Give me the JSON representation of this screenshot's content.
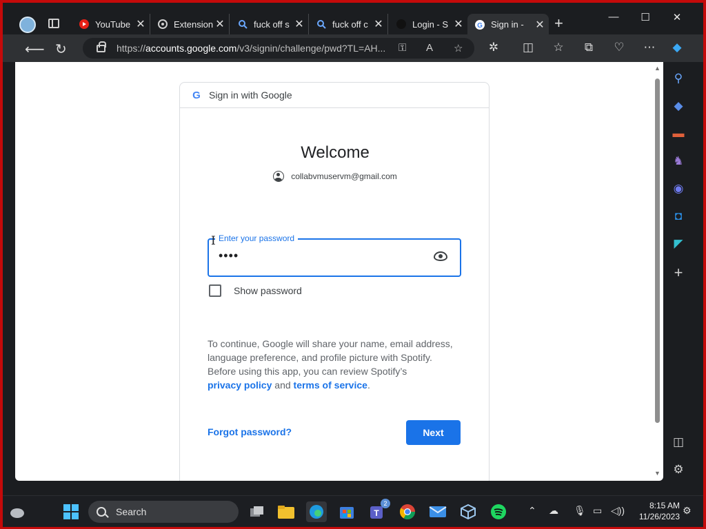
{
  "browser": {
    "tabs": [
      {
        "title": "YouTube",
        "icon": "youtube-icon"
      },
      {
        "title": "Extension",
        "icon": "extension-icon"
      },
      {
        "title": "fuck off s",
        "icon": "search-icon"
      },
      {
        "title": "fuck off c",
        "icon": "search-icon"
      },
      {
        "title": "Login - S",
        "icon": "spotify-icon"
      },
      {
        "title": "Sign in -",
        "icon": "google-icon"
      }
    ],
    "address": {
      "prefix": "https://",
      "domain": "accounts.google.com",
      "path": "/v3/signin/challenge/pwd?TL=AH..."
    }
  },
  "signin": {
    "header": "Sign in with Google",
    "welcome": "Welcome",
    "email": "collabvmuservm@gmail.com",
    "password_label": "Enter your password",
    "password_value": "••••",
    "show_password": "Show password",
    "disclosure_1": "To continue, Google will share your name, email address, language preference, and profile picture with Spotify. Before using this app, you can review Spotify’s",
    "privacy_link": "privacy policy",
    "and": "and",
    "terms_link": "terms of service",
    "period": ".",
    "forgot": "Forgot password?",
    "next": "Next"
  },
  "taskbar": {
    "search_label": "Search",
    "time": "8:15 AM",
    "date": "11/26/2023",
    "teams_badge": "2"
  },
  "colors": {
    "accent": "#1a73e8",
    "frame": "#c40a0a",
    "chrome": "#2f3134"
  }
}
